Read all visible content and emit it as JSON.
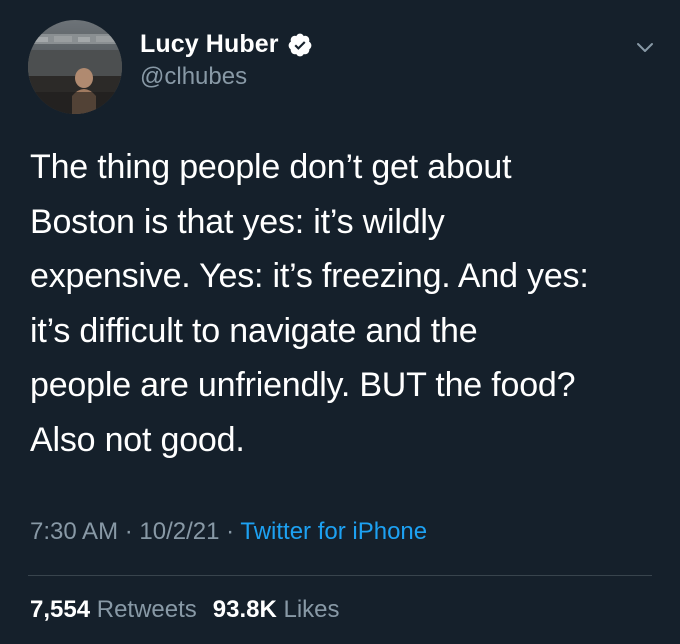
{
  "tweet": {
    "author": {
      "display_name": "Lucy Huber",
      "handle": "@clhubes",
      "verified": true
    },
    "text_lines": [
      "The thing people don’t get about",
      "Boston is that yes: it’s wildly",
      "expensive. Yes: it’s freezing. And yes:",
      "it’s difficult to navigate and the",
      "people are unfriendly. BUT the food?",
      "Also not good."
    ],
    "meta": {
      "time": "7:30 AM",
      "separator1": " · ",
      "date": "10/2/21",
      "separator2": " · ",
      "source": "Twitter for iPhone"
    },
    "stats": {
      "retweets_count": "7,554",
      "retweets_label": " Retweets",
      "likes_count": "93.8K",
      "likes_label": " Likes"
    }
  },
  "colors": {
    "background": "#15202b",
    "text_primary": "#ffffff",
    "text_secondary": "#8899a6",
    "accent": "#1da1f2",
    "divider": "#38444d"
  },
  "icons": {
    "verified": "verified-badge-icon",
    "menu": "chevron-down-icon"
  }
}
